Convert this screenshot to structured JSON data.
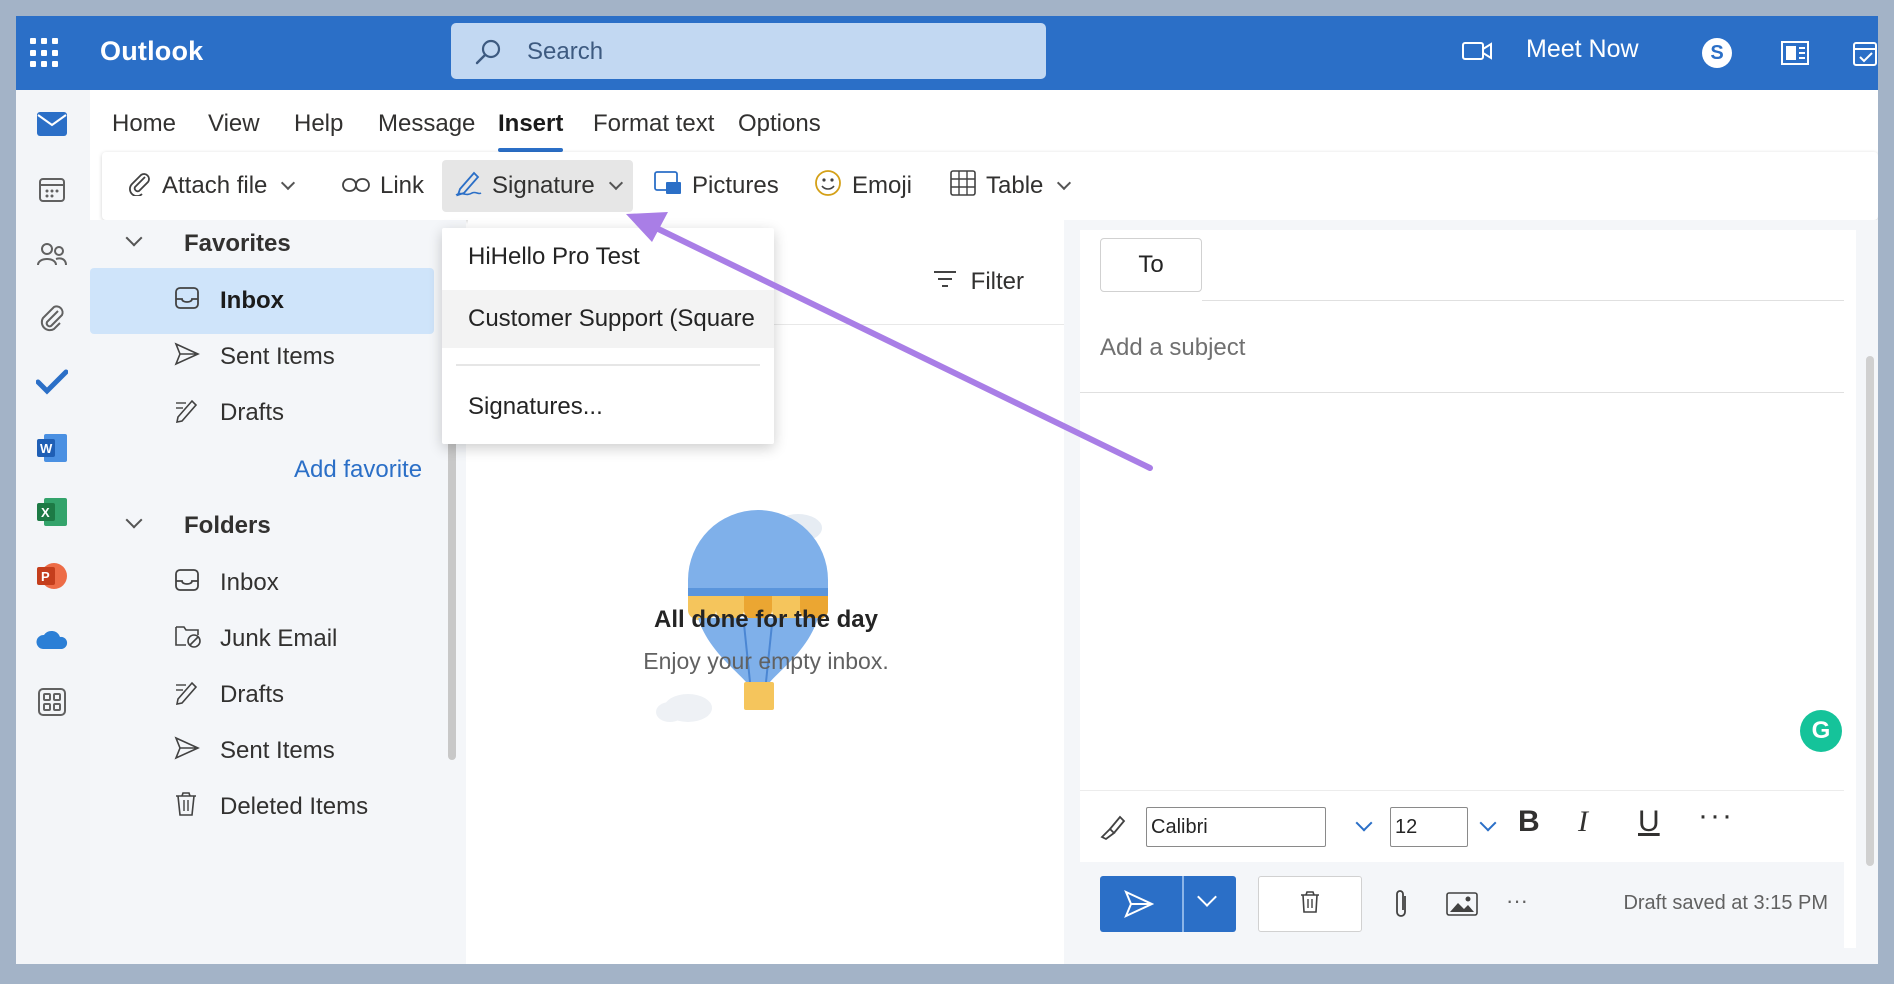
{
  "app": {
    "title": "Outlook"
  },
  "search": {
    "placeholder": "Search"
  },
  "header": {
    "meet_now": "Meet Now"
  },
  "ribbon": {
    "tabs": [
      "Home",
      "View",
      "Help",
      "Message",
      "Insert",
      "Format text",
      "Options"
    ],
    "active_tab": "Insert",
    "tools": {
      "attach": "Attach file",
      "link": "Link",
      "signature": "Signature",
      "pictures": "Pictures",
      "emoji": "Emoji",
      "table": "Table"
    }
  },
  "signature_menu": {
    "items": [
      "HiHello Pro Test",
      "Customer Support (Square",
      "Signatures..."
    ]
  },
  "folders": {
    "favorites_label": "Favorites",
    "favorites": [
      "Inbox",
      "Sent Items",
      "Drafts"
    ],
    "add_favorite": "Add favorite",
    "folders_label": "Folders",
    "items": [
      "Inbox",
      "Junk Email",
      "Drafts",
      "Sent Items",
      "Deleted Items"
    ]
  },
  "message_list": {
    "filter": "Filter",
    "empty_title": "All done for the day",
    "empty_subtitle": "Enjoy your empty inbox."
  },
  "compose": {
    "to": "To",
    "subject_placeholder": "Add a subject",
    "font": "Calibri",
    "font_size": "12",
    "bold": "B",
    "italic": "I",
    "underline": "U",
    "more": "···",
    "draft_status": "Draft saved at 3:15 PM",
    "grammarly": "G"
  },
  "colors": {
    "brand": "#2b6fc7",
    "selected": "#cfe4fa",
    "annotation_arrow": "#a97ee6",
    "grammarly": "#15c39a"
  },
  "icons": {
    "rail": [
      "mail-icon",
      "calendar-icon",
      "people-icon",
      "attach-icon",
      "todo-icon",
      "word-icon",
      "excel-icon",
      "powerpoint-icon",
      "onedrive-icon",
      "apps-icon"
    ]
  }
}
